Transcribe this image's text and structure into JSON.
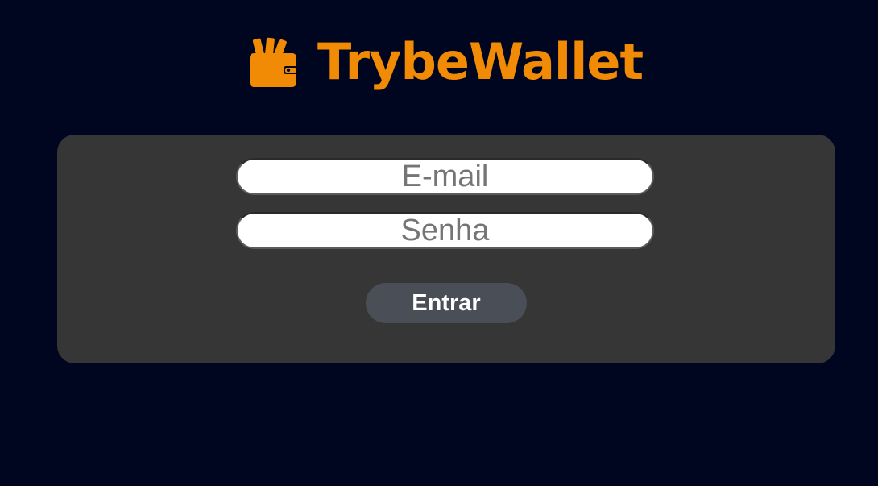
{
  "header": {
    "logo_icon": "wallet-icon",
    "brand": "TrybeWallet",
    "brand_color": "#f18a05"
  },
  "login": {
    "email_placeholder": "E-mail",
    "email_value": "",
    "password_placeholder": "Senha",
    "password_value": "",
    "submit_label": "Entrar"
  },
  "colors": {
    "background": "#00061f",
    "panel": "#363636",
    "button": "#4a4e57"
  }
}
